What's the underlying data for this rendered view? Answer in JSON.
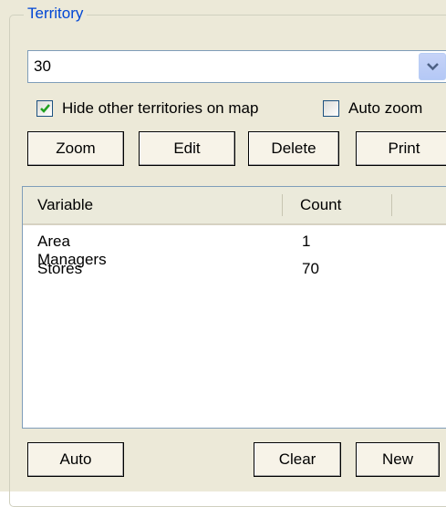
{
  "group": {
    "title": "Territory"
  },
  "territory_select": {
    "value": "30"
  },
  "checkboxes": {
    "hide_other": {
      "label": "Hide other territories on map",
      "checked": true
    },
    "auto_zoom": {
      "label": "Auto zoom",
      "checked": false
    }
  },
  "toolbar": {
    "zoom_label": "Zoom",
    "edit_label": "Edit",
    "delete_label": "Delete",
    "print_label": "Print"
  },
  "table": {
    "columns": [
      "Variable",
      "Count"
    ],
    "rows": [
      {
        "variable": "Area Managers",
        "count": "1"
      },
      {
        "variable": "Stores",
        "count": "70"
      }
    ]
  },
  "footer": {
    "auto_label": "Auto",
    "clear_label": "Clear",
    "new_label": "New"
  },
  "icons": {
    "dropdown": "chevron-down-icon",
    "check": "checkmark-icon"
  },
  "colors": {
    "legend": "#0046d5",
    "panel_bg": "#ece9d8",
    "check_green": "#21a121"
  }
}
